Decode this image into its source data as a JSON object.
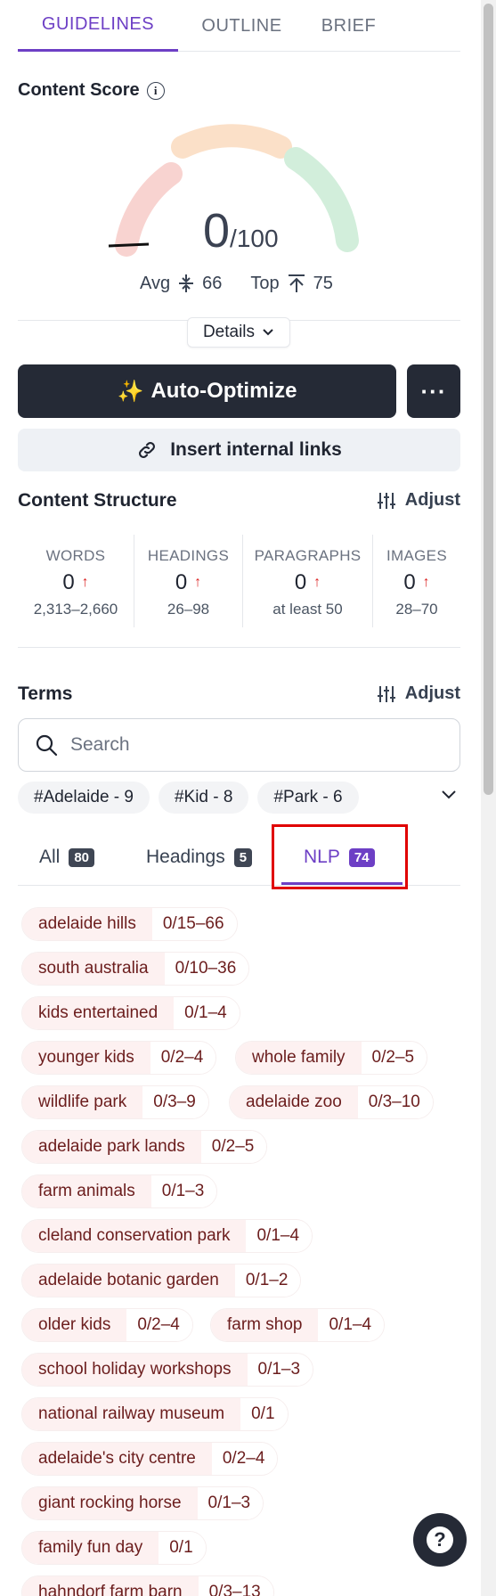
{
  "tabs": [
    {
      "label": "GUIDELINES",
      "active": true
    },
    {
      "label": "OUTLINE",
      "active": false
    },
    {
      "label": "BRIEF",
      "active": false
    }
  ],
  "content_score": {
    "title": "Content Score",
    "value": "0",
    "max": "/100",
    "avg_label": "Avg",
    "avg_value": "66",
    "top_label": "Top",
    "top_value": "75",
    "details_label": "Details"
  },
  "actions": {
    "auto_optimize": "Auto-Optimize",
    "more": "···",
    "insert_links": "Insert internal links"
  },
  "structure": {
    "title": "Content Structure",
    "adjust": "Adjust",
    "stats": [
      {
        "label": "WORDS",
        "value": "0",
        "range": "2,313–2,660"
      },
      {
        "label": "HEADINGS",
        "value": "0",
        "range": "26–98"
      },
      {
        "label": "PARAGRAPHS",
        "value": "0",
        "range": "at least 50"
      },
      {
        "label": "IMAGES",
        "value": "0",
        "range": "28–70"
      }
    ]
  },
  "terms": {
    "title": "Terms",
    "adjust": "Adjust",
    "search_placeholder": "Search",
    "hashtags": [
      "#Adelaide - 9",
      "#Kid - 8",
      "#Park - 6"
    ],
    "filters": [
      {
        "label": "All",
        "count": "80"
      },
      {
        "label": "Headings",
        "count": "5"
      },
      {
        "label": "NLP",
        "count": "74",
        "active": true
      }
    ],
    "items": [
      {
        "name": "adelaide hills",
        "count": "0/15–66"
      },
      {
        "name": "south australia",
        "count": "0/10–36"
      },
      {
        "name": "kids entertained",
        "count": "0/1–4"
      },
      {
        "name": "younger kids",
        "count": "0/2–4"
      },
      {
        "name": "whole family",
        "count": "0/2–5"
      },
      {
        "name": "wildlife park",
        "count": "0/3–9"
      },
      {
        "name": "adelaide zoo",
        "count": "0/3–10"
      },
      {
        "name": "adelaide park lands",
        "count": "0/2–5"
      },
      {
        "name": "farm animals",
        "count": "0/1–3"
      },
      {
        "name": "cleland conservation park",
        "count": "0/1–4"
      },
      {
        "name": "adelaide botanic garden",
        "count": "0/1–2"
      },
      {
        "name": "older kids",
        "count": "0/2–4"
      },
      {
        "name": "farm shop",
        "count": "0/1–4"
      },
      {
        "name": "school holiday workshops",
        "count": "0/1–3"
      },
      {
        "name": "national railway museum",
        "count": "0/1"
      },
      {
        "name": "adelaide's city centre",
        "count": "0/2–4"
      },
      {
        "name": "giant rocking horse",
        "count": "0/1–3"
      },
      {
        "name": "family fun day",
        "count": "0/1"
      },
      {
        "name": "hahndorf farm barn",
        "count": "0/3–13"
      }
    ]
  },
  "help": "?"
}
